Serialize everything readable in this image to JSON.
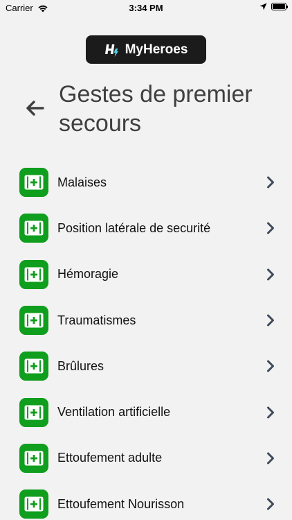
{
  "status_bar": {
    "carrier": "Carrier",
    "time": "3:34 PM"
  },
  "app": {
    "name": "MyHeroes"
  },
  "page": {
    "title": "Gestes de premier secours"
  },
  "items": [
    {
      "label": "Malaises"
    },
    {
      "label": "Position latérale de securité"
    },
    {
      "label": "Hémoragie"
    },
    {
      "label": "Traumatismes"
    },
    {
      "label": "Brûlures"
    },
    {
      "label": "Ventilation artificielle"
    },
    {
      "label": "Ettoufement adulte"
    },
    {
      "label": "Ettoufement Nourisson"
    }
  ],
  "colors": {
    "background": "#f2f2f2",
    "icon_green": "#0f9e1d",
    "logo_background": "#1b1b1b",
    "chevron": "#3f4a5a"
  }
}
